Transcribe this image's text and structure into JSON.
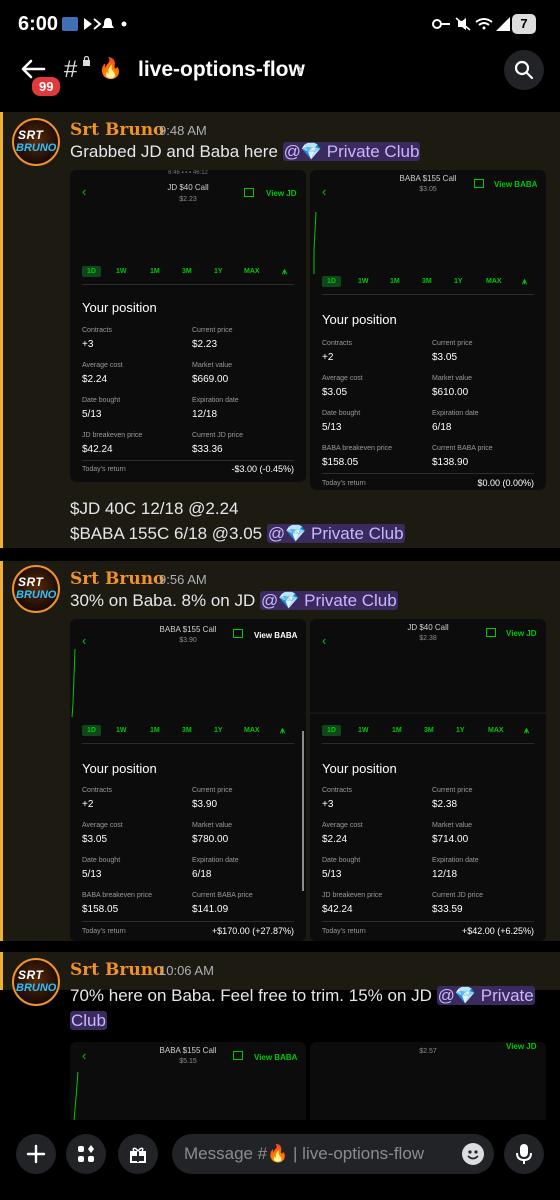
{
  "status": {
    "time": "6:00",
    "battery": "7"
  },
  "header": {
    "unread_badge": "99",
    "channel_emoji": "🔥",
    "channel_name": "live-options-flow",
    "chevron": "›"
  },
  "messages": [
    {
      "author": "Srt Bruno",
      "time": "9:48 AM",
      "avatar_line1": "SRT",
      "avatar_line2": "BRUNO",
      "text_parts": [
        "Grabbed JD and Baba here "
      ],
      "mention": "@💎 Private Club",
      "after_lines": [
        "$JD 40C 12/18 @2.24",
        "$BABA 155C 6/18 @3.05 "
      ],
      "after_mention": "@💎 Private Club",
      "shots": [
        {
          "title": "JD $40 Call",
          "price": "$2.23",
          "view": "View JD",
          "status_clip": "6:46 ▪ ▪ ▪      46:12",
          "ranges": [
            "1D",
            "1W",
            "1M",
            "3M",
            "1Y",
            "MAX"
          ],
          "position_title": "Your position",
          "rows": [
            [
              "Contracts",
              "+3",
              "Current price",
              "$2.23"
            ],
            [
              "Average cost",
              "$2.24",
              "Market value",
              "$669.00"
            ],
            [
              "Date bought",
              "5/13",
              "Expiration date",
              "12/18"
            ],
            [
              "JD breakeven price",
              "$42.24",
              "Current JD price",
              "$33.36"
            ]
          ],
          "return_label": "Today's return",
          "return_value": "-$3.00 (-0.45%)"
        },
        {
          "title": "BABA $155 Call",
          "price": "$3.05",
          "view": "View BABA",
          "ranges": [
            "1D",
            "1W",
            "1M",
            "3M",
            "1Y",
            "MAX"
          ],
          "position_title": "Your position",
          "rows": [
            [
              "Contracts",
              "+2",
              "Current price",
              "$3.05"
            ],
            [
              "Average cost",
              "$3.05",
              "Market value",
              "$610.00"
            ],
            [
              "Date bought",
              "5/13",
              "Expiration date",
              "6/18"
            ],
            [
              "BABA breakeven price",
              "$158.05",
              "Current BABA price",
              "$138.90"
            ]
          ],
          "return_label": "Today's return",
          "return_value": "$0.00 (0.00%)"
        }
      ]
    },
    {
      "author": "Srt Bruno",
      "time": "9:56 AM",
      "avatar_line1": "SRT",
      "avatar_line2": "BRUNO",
      "text_parts": [
        "30% on Baba.  8% on JD "
      ],
      "mention": "@💎 Private Club",
      "shots": [
        {
          "title": "BABA $155 Call",
          "price": "$3.90",
          "view": "View BABA",
          "ranges": [
            "1D",
            "1W",
            "1M",
            "3M",
            "1Y",
            "MAX"
          ],
          "position_title": "Your position",
          "rows": [
            [
              "Contracts",
              "+2",
              "Current price",
              "$3.90"
            ],
            [
              "Average cost",
              "$3.05",
              "Market value",
              "$780.00"
            ],
            [
              "Date bought",
              "5/13",
              "Expiration date",
              "6/18"
            ],
            [
              "BABA breakeven price",
              "$158.05",
              "Current BABA price",
              "$141.09"
            ]
          ],
          "return_label": "Today's return",
          "return_value": "+$170.00 (+27.87%)"
        },
        {
          "title": "JD $40 Call",
          "price": "$2.38",
          "view": "View JD",
          "ranges": [
            "1D",
            "1W",
            "1M",
            "3M",
            "1Y",
            "MAX"
          ],
          "position_title": "Your position",
          "rows": [
            [
              "Contracts",
              "+3",
              "Current price",
              "$2.38"
            ],
            [
              "Average cost",
              "$2.24",
              "Market value",
              "$714.00"
            ],
            [
              "Date bought",
              "5/13",
              "Expiration date",
              "12/18"
            ],
            [
              "JD breakeven price",
              "$42.24",
              "Current JD price",
              "$33.59"
            ]
          ],
          "return_label": "Today's return",
          "return_value": "+$42.00 (+6.25%)"
        }
      ]
    },
    {
      "author": "Srt Bruno",
      "time": "10:06 AM",
      "avatar_line1": "SRT",
      "avatar_line2": "BRUNO",
      "text_line1": "70% here on Baba.  Feel free to trim.  15% on JD ",
      "mention_line1": "@💎 Private",
      "mention_line2": "Club",
      "shots": [
        {
          "title": "BABA $155 Call",
          "price": "$5.15",
          "view": "View BABA"
        },
        {
          "price": "$2.57",
          "view": "View JD"
        }
      ]
    }
  ],
  "composer": {
    "placeholder": "Message #🔥 | live-options-flow"
  }
}
